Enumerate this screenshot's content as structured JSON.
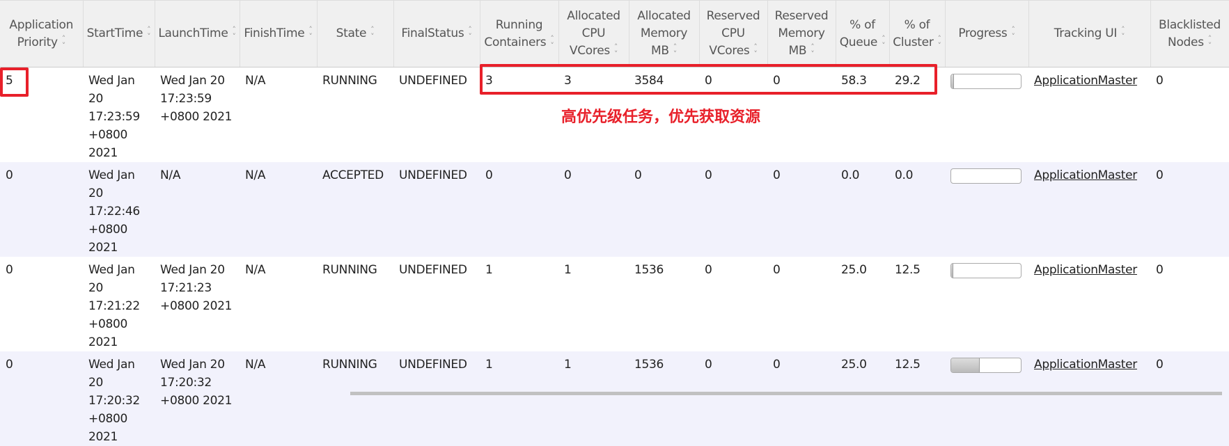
{
  "columns": [
    "Application Priority",
    "StartTime",
    "LaunchTime",
    "FinishTime",
    "State",
    "FinalStatus",
    "Running Containers",
    "Allocated CPU VCores",
    "Allocated Memory MB",
    "Reserved CPU VCores",
    "Reserved Memory MB",
    "% of Queue",
    "% of Cluster",
    "Progress",
    "Tracking UI",
    "Blacklisted Nodes"
  ],
  "rows": [
    {
      "priority": "5",
      "start": "Wed Jan 20 17:23:59 +0800 2021",
      "launch": "Wed Jan 20 17:23:59 +0800 2021",
      "finish": "N/A",
      "state": "RUNNING",
      "final": "UNDEFINED",
      "containers": "3",
      "cpu": "3",
      "mem": "3584",
      "rcpu": "0",
      "rmem": "0",
      "queue": "58.3",
      "cluster": "29.2",
      "progress": 3,
      "tracking": "ApplicationMaster",
      "blacklisted": "0"
    },
    {
      "priority": "0",
      "start": "Wed Jan 20 17:22:46 +0800 2021",
      "launch": "N/A",
      "finish": "N/A",
      "state": "ACCEPTED",
      "final": "UNDEFINED",
      "containers": "0",
      "cpu": "0",
      "mem": "0",
      "rcpu": "0",
      "rmem": "0",
      "queue": "0.0",
      "cluster": "0.0",
      "progress": 0,
      "tracking": "ApplicationMaster",
      "blacklisted": "0"
    },
    {
      "priority": "0",
      "start": "Wed Jan 20 17:21:22 +0800 2021",
      "launch": "Wed Jan 20 17:21:23 +0800 2021",
      "finish": "N/A",
      "state": "RUNNING",
      "final": "UNDEFINED",
      "containers": "1",
      "cpu": "1",
      "mem": "1536",
      "rcpu": "0",
      "rmem": "0",
      "queue": "25.0",
      "cluster": "12.5",
      "progress": 2,
      "tracking": "ApplicationMaster",
      "blacklisted": "0"
    },
    {
      "priority": "0",
      "start": "Wed Jan 20 17:20:32 +0800 2021",
      "launch": "Wed Jan 20 17:20:32 +0800 2021",
      "finish": "N/A",
      "state": "RUNNING",
      "final": "UNDEFINED",
      "containers": "1",
      "cpu": "1",
      "mem": "1536",
      "rcpu": "0",
      "rmem": "0",
      "queue": "25.0",
      "cluster": "12.5",
      "progress": 40,
      "tracking": "ApplicationMaster",
      "blacklisted": "0"
    }
  ],
  "annotation": "高优先级任务，优先获取资源",
  "colors": {
    "annotation": "#e8202a",
    "odd_row": "#f2f2fc",
    "header": "#f0f0f0"
  }
}
